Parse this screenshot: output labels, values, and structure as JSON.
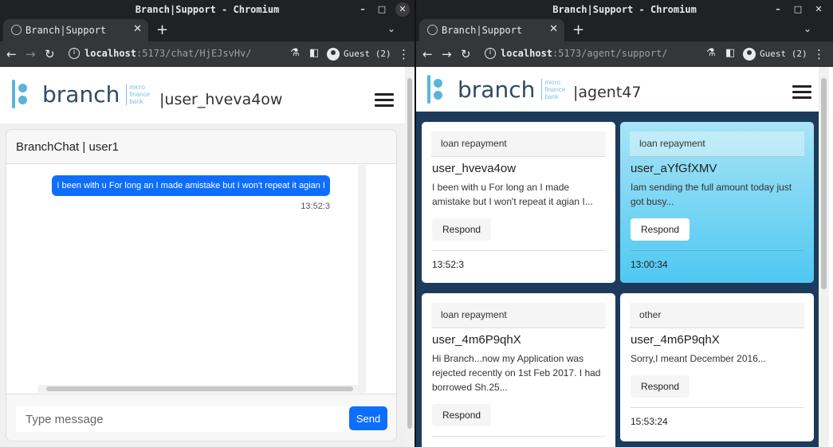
{
  "left_window": {
    "title": "Branch|Support - Chromium",
    "tab_label": "Branch|Support",
    "url_host": "localhost",
    "url_path": ":5173/chat/HjEJsvHv/",
    "profile": "Guest (2)",
    "logo": {
      "word": "branch",
      "sub1": "micro",
      "sub2": "finance",
      "sub3": "bank"
    },
    "header_user": "|user_hveva4ow",
    "chat": {
      "title": "BranchChat | user1",
      "messages": [
        {
          "text": "I been with u For long an I made amistake but I won't repeat it agian I",
          "time": "13:52:3"
        }
      ],
      "input_placeholder": "Type message",
      "send_label": "Send"
    }
  },
  "right_window": {
    "title": "Branch|Support - Chromium",
    "tab_label": "Branch|Support",
    "url_host": "localhost",
    "url_path": ":5173/agent/support/",
    "profile": "Guest (2)",
    "logo": {
      "word": "branch",
      "sub1": "micro",
      "sub2": "finance",
      "sub3": "bank"
    },
    "header_agent": "|agent47",
    "tickets": [
      {
        "category": "loan repayment",
        "user": "user_hveva4ow",
        "preview": "I been with u For long an I made amistake but I won't repeat it agian I...",
        "respond": "Respond",
        "time": "13:52:3",
        "active": false
      },
      {
        "category": "loan repayment",
        "user": "user_aYfGfXMV",
        "preview": "Iam sending the full amount today just got busy...",
        "respond": "Respond",
        "time": "13:00:34",
        "active": true
      },
      {
        "category": "loan repayment",
        "user": "user_4m6P9qhX",
        "preview": "Hi Branch...now my Application was rejected recently on 1st Feb 2017. I had borrowed Sh.25...",
        "respond": "Respond",
        "time": "",
        "active": false
      },
      {
        "category": "other",
        "user": "user_4m6P9qhX",
        "preview": "Sorry,I meant December 2016...",
        "respond": "Respond",
        "time": "15:53:24",
        "active": false
      }
    ]
  },
  "colors": {
    "brand": "#2e4a66",
    "accent": "#5ab4d8",
    "primary": "#0d6efd",
    "agent_bg": "#1b3a5c",
    "active_card": "#4fc8f1"
  }
}
